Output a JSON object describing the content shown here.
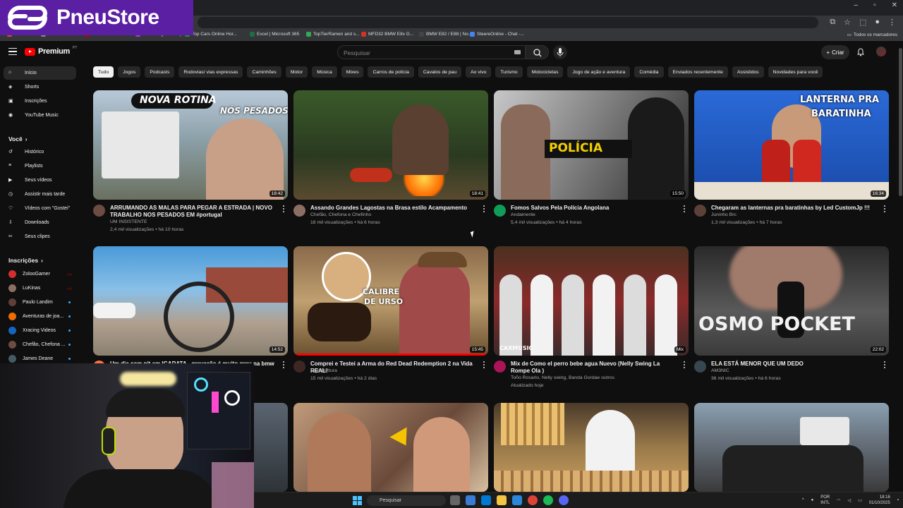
{
  "logo": {
    "text": "PneuStore"
  },
  "bookmarks": [
    {
      "label": "Gmail",
      "color": "#ea4335"
    },
    {
      "label": "FAIS-2005 MaIsab...",
      "color": "#888888"
    },
    {
      "label": "E3 meta V2.5 full ol...",
      "color": "#c00000"
    },
    {
      "label": "StreamingService |...",
      "color": "#a03bd6"
    },
    {
      "label": "Top Cars Online Hor...",
      "color": "#1e8e3e"
    },
    {
      "label": "Excel | Microsoft 365",
      "color": "#1d6f42"
    },
    {
      "label": "TopTierRamen and s...",
      "color": "#34a853"
    },
    {
      "label": "MFD32 BMW E8x G...",
      "color": "#d93025"
    },
    {
      "label": "BMW E82 / E88 | No...",
      "color": "#444444"
    },
    {
      "label": "SteereOnline - Chat -...",
      "color": "#4285f4"
    }
  ],
  "bookmarks_all": "Todos os marcadores",
  "header": {
    "brand": "Premium",
    "region": "PT",
    "search_placeholder": "Pesquisar",
    "create_label": "Criar"
  },
  "sidebar": {
    "main": [
      {
        "label": "Início",
        "icon": "home-icon",
        "active": true
      },
      {
        "label": "Shorts",
        "icon": "shorts-icon"
      },
      {
        "label": "Inscrições",
        "icon": "subscriptions-icon"
      },
      {
        "label": "YouTube Music",
        "icon": "music-icon"
      }
    ],
    "you_title": "Você",
    "you": [
      {
        "label": "Histórico",
        "icon": "history-icon"
      },
      {
        "label": "Playlists",
        "icon": "playlist-icon"
      },
      {
        "label": "Seus vídeos",
        "icon": "video-icon"
      },
      {
        "label": "Assistir mais tarde",
        "icon": "clock-icon"
      },
      {
        "label": "Vídeos com \"Gostei\"",
        "icon": "like-icon"
      },
      {
        "label": "Downloads",
        "icon": "download-icon"
      },
      {
        "label": "Seus clipes",
        "icon": "scissors-icon"
      }
    ],
    "subs_title": "Inscrições",
    "subs": [
      {
        "label": "ZolooGamer",
        "color": "#d32f2f",
        "live": "red"
      },
      {
        "label": "LuKinas",
        "color": "#8d6e63",
        "live": "red"
      },
      {
        "label": "Paulo Landim",
        "color": "#5d4037",
        "live": "blue"
      },
      {
        "label": "Aventuras de joa...",
        "color": "#ef6c00",
        "live": "blue"
      },
      {
        "label": "Xracing Videos",
        "color": "#1565c0",
        "live": "blue"
      },
      {
        "label": "Chefão, Chefona ...",
        "color": "#6d4c41",
        "live": "blue"
      },
      {
        "label": "James Deane",
        "color": "#455a64",
        "live": "blue"
      }
    ]
  },
  "chips": [
    "Tudo",
    "Jogos",
    "Podcasts",
    "Rodovias/ vias expressas",
    "Caminhões",
    "Motor",
    "Música",
    "Mixes",
    "Carros de polícia",
    "Cavalos de pau",
    "Ao vivo",
    "Turismo",
    "Motocicletas",
    "Jogo de ação e aventura",
    "Comédia",
    "Enviados recentemente",
    "Assistidos",
    "Novidades para você"
  ],
  "videos": [
    {
      "title": "ARRUMANDO AS MALAS PARA PEGAR A ESTRADA | NOVO TRABALHO NOS PESADOS EM #portugal",
      "channel": "UM INSISTENTE",
      "stats": "2,4 mil visualizações • há 10 horas",
      "duration": "18:42",
      "thumb_text": "NOVA ROTINA",
      "thumb_text2": "NÓS PESADOS"
    },
    {
      "title": "Assando Grandes Lagostas na Brasa estilo Acampamento",
      "channel": "Chefão, Chefona e Chefinho",
      "stats": "18 mil visualizações • há 6 horas",
      "duration": "18:41"
    },
    {
      "title": "Fomos Salvos Pela Polícia Angolana",
      "channel": "Andamente",
      "stats": "5,4 mil visualizações • há 4 horas",
      "duration": "15:50",
      "thumb_text": "POLÍCIA"
    },
    {
      "title": "Chegaram as lanternas pra baratinhas by Led CustomJp !!!",
      "channel": "Juninho Brc",
      "stats": "1,3 mil visualizações • há 7 horas",
      "duration": "16:34",
      "thumb_text": "LANTERNA PRA",
      "thumb_text2": "BARATINHA"
    },
    {
      "title": "Um dia com pit em IGARATA - gravação é muito grau na bmw",
      "channel": "",
      "stats": "",
      "duration": "14:52"
    },
    {
      "title": "Comprei e Testei a Arma do Red Dead Redemption 2 na Vida REAL!",
      "channel": "Caio Bottura",
      "stats": "15 mil visualizações • há 2 dias",
      "duration": "15:45",
      "thumb_text": "CALIBRE",
      "thumb_text2": "DE URSO"
    },
    {
      "title": "Mix de Como el perro bebe agua Nuevo  (Nelly Swing La Rompe Ola )",
      "channel": "Toño Rosario, Nelly swing, Banda Gordae outros",
      "stats": "Atualizado hoje",
      "duration": "Mix",
      "thumb_text": "CAXMUSIC"
    },
    {
      "title": "ELA ESTÁ MENOR QUE UM DEDO",
      "channel": "AM3NIC",
      "stats": "36 mil visualizações • há 6 horas",
      "duration": "22:02",
      "thumb_text": "OSMO POCKET"
    }
  ],
  "taskbar": {
    "search_label": "Pesquisar",
    "lang": "POR",
    "lang2": "INTL",
    "time": "18:16",
    "date": "01/10/2025"
  }
}
